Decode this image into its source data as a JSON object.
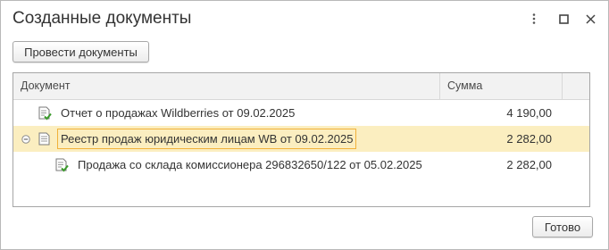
{
  "window": {
    "title": "Созданные документы"
  },
  "toolbar": {
    "post_label": "Провести документы"
  },
  "table": {
    "columns": [
      "Документ",
      "Сумма"
    ],
    "rows": [
      {
        "document": "Отчет о продажах Wildberries от 09.02.2025",
        "amount": "4 190,00"
      },
      {
        "document": "Реестр продаж юридическим лицам WB от 09.02.2025",
        "amount": "2 282,00"
      },
      {
        "document": "Продажа со склада комиссионера 296832650/122 от 05.02.2025",
        "amount": "2 282,00"
      }
    ]
  },
  "footer": {
    "done_label": "Готово"
  },
  "colors": {
    "selected_row": "#fbeec0",
    "focus_border": "#f1b13b",
    "posted_check": "#3a9a2a"
  },
  "icons": {
    "more": "more-vertical-icon",
    "maximize": "maximize-icon",
    "close": "close-icon",
    "collapse": "collapse-icon",
    "document_posted": "document-posted-icon",
    "document": "document-icon"
  }
}
